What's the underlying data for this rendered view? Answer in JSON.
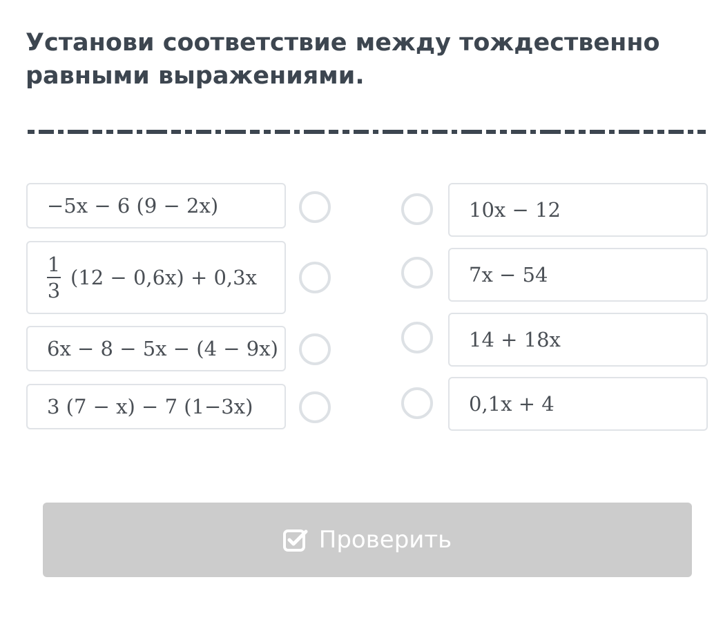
{
  "task": {
    "title": "Установи соответствие между тождественно равными выражениями."
  },
  "left_items": [
    {
      "expr": "−5x − 6 (9 − 2x)"
    },
    {
      "numerator": "1",
      "denominator": "3",
      "expr": "(12 − 0,6x) + 0,3x"
    },
    {
      "expr": "6x − 8 − 5x − (4 − 9x)"
    },
    {
      "expr": "3 (7 − x) − 7 (1−3x)"
    }
  ],
  "right_items": [
    {
      "expr": "10x − 12"
    },
    {
      "expr": "7x − 54"
    },
    {
      "expr": "14 + 18x"
    },
    {
      "expr": "0,1x + 4"
    }
  ],
  "check_button": {
    "label": "Проверить",
    "icon": "checkbox-check-icon"
  },
  "colors": {
    "title": "#3d4650",
    "card_border": "#e0e3e7",
    "radio_border": "#dde1e5",
    "button_bg": "#cccccc",
    "button_text": "#ffffff"
  }
}
